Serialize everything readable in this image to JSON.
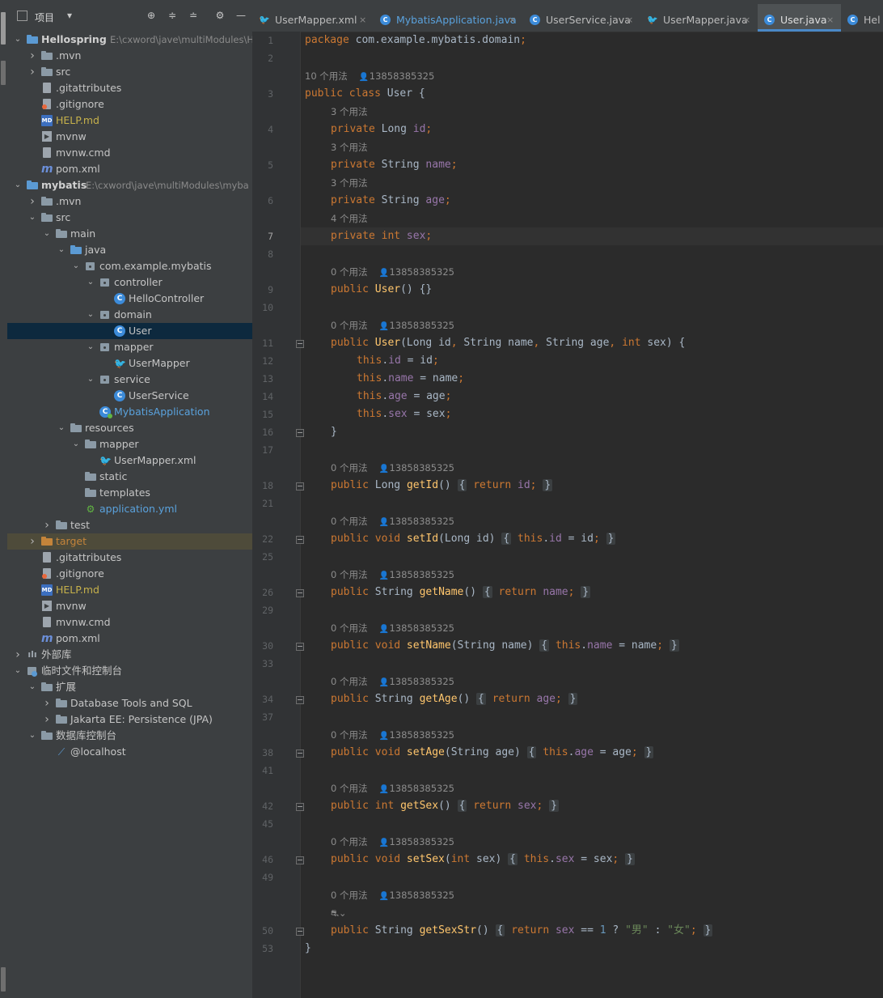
{
  "project_panel": {
    "title": "项目",
    "tree": [
      {
        "label": "Hellospring",
        "path": "E:\\cxword\\jave\\multiModules\\H",
        "bold": true,
        "depth": 0,
        "arrow": "down",
        "icon": "module"
      },
      {
        "label": ".mvn",
        "depth": 1,
        "arrow": "right",
        "icon": "folder"
      },
      {
        "label": "src",
        "depth": 1,
        "arrow": "right",
        "icon": "folder"
      },
      {
        "label": ".gitattributes",
        "depth": 1,
        "icon": "file"
      },
      {
        "label": ".gitignore",
        "depth": 1,
        "icon": "git"
      },
      {
        "label": "HELP.md",
        "depth": 1,
        "icon": "md",
        "color": "yellow"
      },
      {
        "label": "mvnw",
        "depth": 1,
        "icon": "term"
      },
      {
        "label": "mvnw.cmd",
        "depth": 1,
        "icon": "file"
      },
      {
        "label": "pom.xml",
        "depth": 1,
        "icon": "mvn"
      },
      {
        "label": "mybatis",
        "path": "E:\\cxword\\jave\\multiModules\\myba",
        "bold": true,
        "depth": 0,
        "arrow": "down",
        "icon": "module"
      },
      {
        "label": ".mvn",
        "depth": 1,
        "arrow": "right",
        "icon": "folder"
      },
      {
        "label": "src",
        "depth": 1,
        "arrow": "down",
        "icon": "folder"
      },
      {
        "label": "main",
        "depth": 2,
        "arrow": "down",
        "icon": "folder"
      },
      {
        "label": "java",
        "depth": 3,
        "arrow": "down",
        "icon": "bluefolder"
      },
      {
        "label": "com.example.mybatis",
        "depth": 4,
        "arrow": "down",
        "icon": "pkg"
      },
      {
        "label": "controller",
        "depth": 5,
        "arrow": "down",
        "icon": "pkg"
      },
      {
        "label": "HelloController",
        "depth": 6,
        "icon": "class"
      },
      {
        "label": "domain",
        "depth": 5,
        "arrow": "down",
        "icon": "pkg"
      },
      {
        "label": "User",
        "depth": 6,
        "icon": "class",
        "selected": true
      },
      {
        "label": "mapper",
        "depth": 5,
        "arrow": "down",
        "icon": "pkg"
      },
      {
        "label": "UserMapper",
        "depth": 6,
        "icon": "xml"
      },
      {
        "label": "service",
        "depth": 5,
        "arrow": "down",
        "icon": "pkg"
      },
      {
        "label": "UserService",
        "depth": 6,
        "icon": "class"
      },
      {
        "label": "MybatisApplication",
        "depth": 5,
        "icon": "classrun",
        "color": "blue"
      },
      {
        "label": "resources",
        "depth": 3,
        "arrow": "down",
        "icon": "folder"
      },
      {
        "label": "mapper",
        "depth": 4,
        "arrow": "down",
        "icon": "folder"
      },
      {
        "label": "UserMapper.xml",
        "depth": 5,
        "icon": "xml"
      },
      {
        "label": "static",
        "depth": 4,
        "icon": "folder"
      },
      {
        "label": "templates",
        "depth": 4,
        "icon": "folder"
      },
      {
        "label": "application.yml",
        "depth": 4,
        "icon": "yml",
        "color": "blue"
      },
      {
        "label": "test",
        "depth": 2,
        "arrow": "right",
        "icon": "folder"
      },
      {
        "label": "target",
        "depth": 1,
        "arrow": "right",
        "icon": "orangefolder",
        "color": "orange",
        "target": true
      },
      {
        "label": ".gitattributes",
        "depth": 1,
        "icon": "file"
      },
      {
        "label": ".gitignore",
        "depth": 1,
        "icon": "git"
      },
      {
        "label": "HELP.md",
        "depth": 1,
        "icon": "md",
        "color": "yellow"
      },
      {
        "label": "mvnw",
        "depth": 1,
        "icon": "term"
      },
      {
        "label": "mvnw.cmd",
        "depth": 1,
        "icon": "file"
      },
      {
        "label": "pom.xml",
        "depth": 1,
        "icon": "mvn"
      },
      {
        "label": "外部库",
        "depth": 0,
        "arrow": "right",
        "icon": "lib"
      },
      {
        "label": "临时文件和控制台",
        "depth": 0,
        "arrow": "down",
        "icon": "scratch"
      },
      {
        "label": "扩展",
        "depth": 1,
        "arrow": "down",
        "icon": "folder"
      },
      {
        "label": "Database Tools and SQL",
        "depth": 2,
        "arrow": "right",
        "icon": "folder"
      },
      {
        "label": "Jakarta EE: Persistence (JPA)",
        "depth": 2,
        "arrow": "right",
        "icon": "folder"
      },
      {
        "label": "数据库控制台",
        "depth": 1,
        "arrow": "down",
        "icon": "folder"
      },
      {
        "label": "@localhost",
        "depth": 2,
        "icon": "db"
      }
    ]
  },
  "tabs": [
    {
      "label": "UserMapper.xml",
      "icon": "xml"
    },
    {
      "label": "MybatisApplication.java",
      "icon": "classrun",
      "color": "#5aa2dd"
    },
    {
      "label": "UserService.java",
      "icon": "class"
    },
    {
      "label": "UserMapper.java",
      "icon": "xml"
    },
    {
      "label": "User.java",
      "icon": "class",
      "active": true
    },
    {
      "label": "Hel",
      "icon": "class"
    }
  ],
  "editor": {
    "current_line": "7",
    "hint_author": "13858385325",
    "lines": [
      {
        "t": "line",
        "n": "1",
        "indent": 0,
        "html": "<span class=\"kw\">package</span> com.example.mybatis.domain<span class=\"kw\">;</span>"
      },
      {
        "t": "line",
        "n": "2",
        "indent": 0,
        "html": ""
      },
      {
        "t": "hint",
        "text": "10 个用法",
        "author": true,
        "indent": 0
      },
      {
        "t": "line",
        "n": "3",
        "indent": 0,
        "html": "<span class=\"kw\">public class</span> User {"
      },
      {
        "t": "hint",
        "text": "3 个用法",
        "indent": 1
      },
      {
        "t": "line",
        "n": "4",
        "indent": 1,
        "html": "<span class=\"kw\">private</span> Long <span class=\"fld\">id</span><span class=\"kw\">;</span>"
      },
      {
        "t": "hint",
        "text": "3 个用法",
        "indent": 1
      },
      {
        "t": "line",
        "n": "5",
        "indent": 1,
        "html": "<span class=\"kw\">private</span> String <span class=\"fld\">name</span><span class=\"kw\">;</span>"
      },
      {
        "t": "hint",
        "text": "3 个用法",
        "indent": 1
      },
      {
        "t": "line",
        "n": "6",
        "indent": 1,
        "html": "<span class=\"kw\">private</span> String <span class=\"fld\">age</span><span class=\"kw\">;</span>"
      },
      {
        "t": "hint",
        "text": "4 个用法",
        "indent": 1
      },
      {
        "t": "line",
        "n": "7",
        "indent": 1,
        "current": true,
        "html": "<span class=\"kw\">private int</span> <span class=\"fld\">sex</span><span class=\"kw\">;</span>"
      },
      {
        "t": "line",
        "n": "8",
        "indent": 0,
        "html": ""
      },
      {
        "t": "hint",
        "text": "0 个用法",
        "author": true,
        "indent": 1
      },
      {
        "t": "line",
        "n": "9",
        "indent": 1,
        "html": "<span class=\"kw\">public</span> <span class=\"fn\">User</span>() {}"
      },
      {
        "t": "line",
        "n": "10",
        "indent": 0,
        "html": ""
      },
      {
        "t": "hint",
        "text": "0 个用法",
        "author": true,
        "indent": 1
      },
      {
        "t": "line",
        "n": "11",
        "indent": 1,
        "fold": true,
        "html": "<span class=\"kw\">public</span> <span class=\"fn\">User</span>(Long id<span class=\"kw\">,</span> String name<span class=\"kw\">,</span> String age<span class=\"kw\">,</span> <span class=\"kw\">int</span> sex) {"
      },
      {
        "t": "line",
        "n": "12",
        "indent": 2,
        "html": "<span class=\"kw\">this</span>.<span class=\"fld\">id</span> = id<span class=\"kw\">;</span>"
      },
      {
        "t": "line",
        "n": "13",
        "indent": 2,
        "html": "<span class=\"kw\">this</span>.<span class=\"fld\">name</span> = name<span class=\"kw\">;</span>"
      },
      {
        "t": "line",
        "n": "14",
        "indent": 2,
        "html": "<span class=\"kw\">this</span>.<span class=\"fld\">age</span> = age<span class=\"kw\">;</span>"
      },
      {
        "t": "line",
        "n": "15",
        "indent": 2,
        "html": "<span class=\"kw\">this</span>.<span class=\"fld\">sex</span> = sex<span class=\"kw\">;</span>"
      },
      {
        "t": "line",
        "n": "16",
        "indent": 1,
        "fold": true,
        "html": "}"
      },
      {
        "t": "line",
        "n": "17",
        "indent": 0,
        "html": ""
      },
      {
        "t": "hint",
        "text": "0 个用法",
        "author": true,
        "indent": 1
      },
      {
        "t": "line",
        "n": "18",
        "indent": 1,
        "fold": true,
        "html": "<span class=\"kw\">public</span> Long <span class=\"fn\">getId</span>() <span class=\"bx\">{</span> <span class=\"kw\">return</span> <span class=\"fld\">id</span><span class=\"kw\">;</span> <span class=\"bx\">}</span>"
      },
      {
        "t": "line",
        "n": "21",
        "indent": 0,
        "html": ""
      },
      {
        "t": "hint",
        "text": "0 个用法",
        "author": true,
        "indent": 1
      },
      {
        "t": "line",
        "n": "22",
        "indent": 1,
        "fold": true,
        "html": "<span class=\"kw\">public void</span> <span class=\"fn\">setId</span>(Long id) <span class=\"bx\">{</span> <span class=\"kw\">this</span>.<span class=\"fld\">id</span> = id<span class=\"kw\">;</span> <span class=\"bx\">}</span>"
      },
      {
        "t": "line",
        "n": "25",
        "indent": 0,
        "html": ""
      },
      {
        "t": "hint",
        "text": "0 个用法",
        "author": true,
        "indent": 1
      },
      {
        "t": "line",
        "n": "26",
        "indent": 1,
        "fold": true,
        "html": "<span class=\"kw\">public</span> String <span class=\"fn\">getName</span>() <span class=\"bx\">{</span> <span class=\"kw\">return</span> <span class=\"fld\">name</span><span class=\"kw\">;</span> <span class=\"bx\">}</span>"
      },
      {
        "t": "line",
        "n": "29",
        "indent": 0,
        "html": ""
      },
      {
        "t": "hint",
        "text": "0 个用法",
        "author": true,
        "indent": 1
      },
      {
        "t": "line",
        "n": "30",
        "indent": 1,
        "fold": true,
        "html": "<span class=\"kw\">public void</span> <span class=\"fn\">setName</span>(String name) <span class=\"bx\">{</span> <span class=\"kw\">this</span>.<span class=\"fld\">name</span> = name<span class=\"kw\">;</span> <span class=\"bx\">}</span>"
      },
      {
        "t": "line",
        "n": "33",
        "indent": 0,
        "html": ""
      },
      {
        "t": "hint",
        "text": "0 个用法",
        "author": true,
        "indent": 1
      },
      {
        "t": "line",
        "n": "34",
        "indent": 1,
        "fold": true,
        "html": "<span class=\"kw\">public</span> String <span class=\"fn\">getAge</span>() <span class=\"bx\">{</span> <span class=\"kw\">return</span> <span class=\"fld\">age</span><span class=\"kw\">;</span> <span class=\"bx\">}</span>"
      },
      {
        "t": "line",
        "n": "37",
        "indent": 0,
        "html": ""
      },
      {
        "t": "hint",
        "text": "0 个用法",
        "author": true,
        "indent": 1
      },
      {
        "t": "line",
        "n": "38",
        "indent": 1,
        "fold": true,
        "html": "<span class=\"kw\">public void</span> <span class=\"fn\">setAge</span>(String age) <span class=\"bx\">{</span> <span class=\"kw\">this</span>.<span class=\"fld\">age</span> = age<span class=\"kw\">;</span> <span class=\"bx\">}</span>"
      },
      {
        "t": "line",
        "n": "41",
        "indent": 0,
        "html": ""
      },
      {
        "t": "hint",
        "text": "0 个用法",
        "author": true,
        "indent": 1
      },
      {
        "t": "line",
        "n": "42",
        "indent": 1,
        "fold": true,
        "html": "<span class=\"kw\">public int</span> <span class=\"fn\">getSex</span>() <span class=\"bx\">{</span> <span class=\"kw\">return</span> <span class=\"fld\">sex</span><span class=\"kw\">;</span> <span class=\"bx\">}</span>"
      },
      {
        "t": "line",
        "n": "45",
        "indent": 0,
        "html": ""
      },
      {
        "t": "hint",
        "text": "0 个用法",
        "author": true,
        "indent": 1
      },
      {
        "t": "line",
        "n": "46",
        "indent": 1,
        "fold": true,
        "html": "<span class=\"kw\">public void</span> <span class=\"fn\">setSex</span>(<span class=\"kw\">int</span> sex) <span class=\"bx\">{</span> <span class=\"kw\">this</span>.<span class=\"fld\">sex</span> = sex<span class=\"kw\">;</span> <span class=\"bx\">}</span>"
      },
      {
        "t": "line",
        "n": "49",
        "indent": 0,
        "html": ""
      },
      {
        "t": "hint",
        "text": "0 个用法",
        "author": true,
        "indent": 1
      },
      {
        "t": "hint",
        "text": "⛐⌄",
        "indent": 1
      },
      {
        "t": "line",
        "n": "50",
        "indent": 1,
        "fold": true,
        "html": "<span class=\"kw\">public</span> String <span class=\"fn\">getSexStr</span>() <span class=\"bx\">{</span> <span class=\"kw\">return</span> <span class=\"fld\">sex</span> == <span class=\"num\">1</span> ? <span class=\"str\">\"男\"</span> : <span class=\"str\">\"女\"</span><span class=\"kw\">;</span> <span class=\"bx\">}</span>"
      },
      {
        "t": "line",
        "n": "53",
        "indent": 0,
        "html": "}"
      }
    ]
  }
}
